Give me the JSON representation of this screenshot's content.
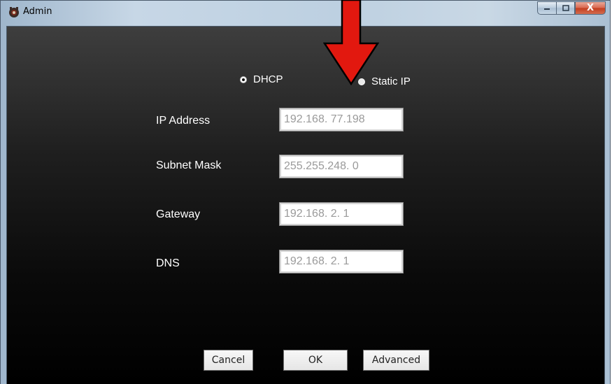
{
  "window": {
    "title": "Admin",
    "icons": {
      "app": "app-icon",
      "minimize": "minimize-icon",
      "maximize": "maximize-icon",
      "close": "close-icon"
    },
    "close_glyph": "X"
  },
  "mode": {
    "options": [
      {
        "label": "DHCP",
        "selected": true
      },
      {
        "label": "Static IP",
        "selected": false
      }
    ]
  },
  "fields": [
    {
      "label": "IP Address",
      "value": "192.168. 77.198"
    },
    {
      "label": "Subnet Mask",
      "value": "255.255.248.  0"
    },
    {
      "label": "Gateway",
      "value": "192.168.  2.  1"
    },
    {
      "label": "DNS",
      "value": "192.168.  2.  1"
    }
  ],
  "buttons": {
    "cancel": "Cancel",
    "ok": "OK",
    "advanced": "Advanced"
  },
  "annotation": {
    "icon": "red-arrow-icon",
    "color": "#e2180f"
  }
}
